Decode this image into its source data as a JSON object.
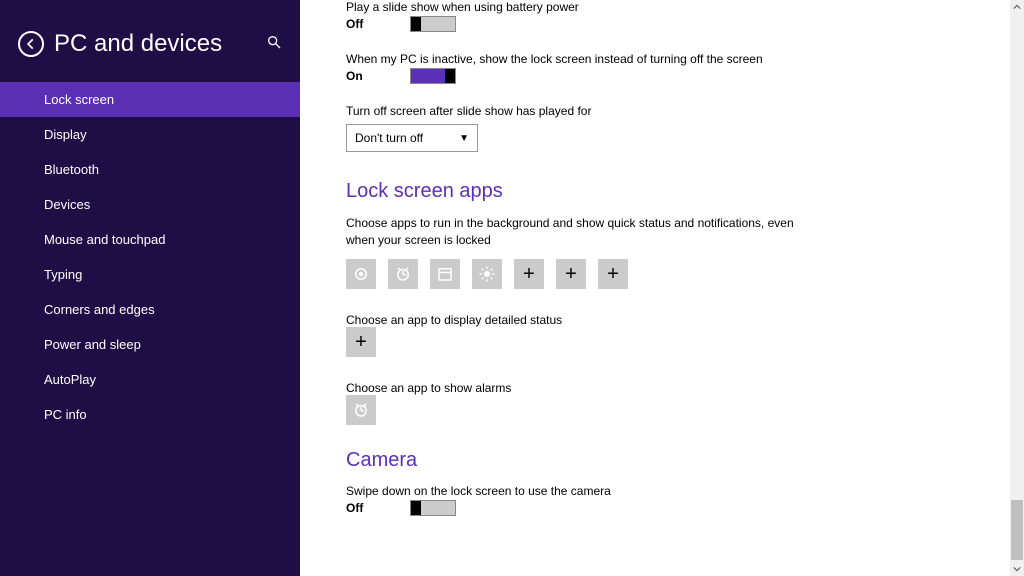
{
  "header": {
    "title": "PC and devices"
  },
  "sidebar": {
    "items": [
      {
        "label": "Lock screen",
        "active": true
      },
      {
        "label": "Display"
      },
      {
        "label": "Bluetooth"
      },
      {
        "label": "Devices"
      },
      {
        "label": "Mouse and touchpad"
      },
      {
        "label": "Typing"
      },
      {
        "label": "Corners and edges"
      },
      {
        "label": "Power and sleep"
      },
      {
        "label": "AutoPlay"
      },
      {
        "label": "PC info"
      }
    ]
  },
  "settings": {
    "slideshow_battery": {
      "label": "Play a slide show when using battery power",
      "value": "Off"
    },
    "inactive_lockscreen": {
      "label": "When my PC is inactive, show the lock screen instead of turning off the screen",
      "value": "On"
    },
    "turnoff_after": {
      "label": "Turn off screen after slide show has played for",
      "selected": "Don't turn off"
    },
    "lock_apps": {
      "title": "Lock screen apps",
      "desc": "Choose apps to run in the background and show quick status and notifications, even when your screen is locked",
      "detailed_label": "Choose an app to display detailed status",
      "alarms_label": "Choose an app to show alarms"
    },
    "camera": {
      "title": "Camera",
      "desc": "Swipe down on the lock screen to use the camera",
      "value": "Off"
    }
  }
}
